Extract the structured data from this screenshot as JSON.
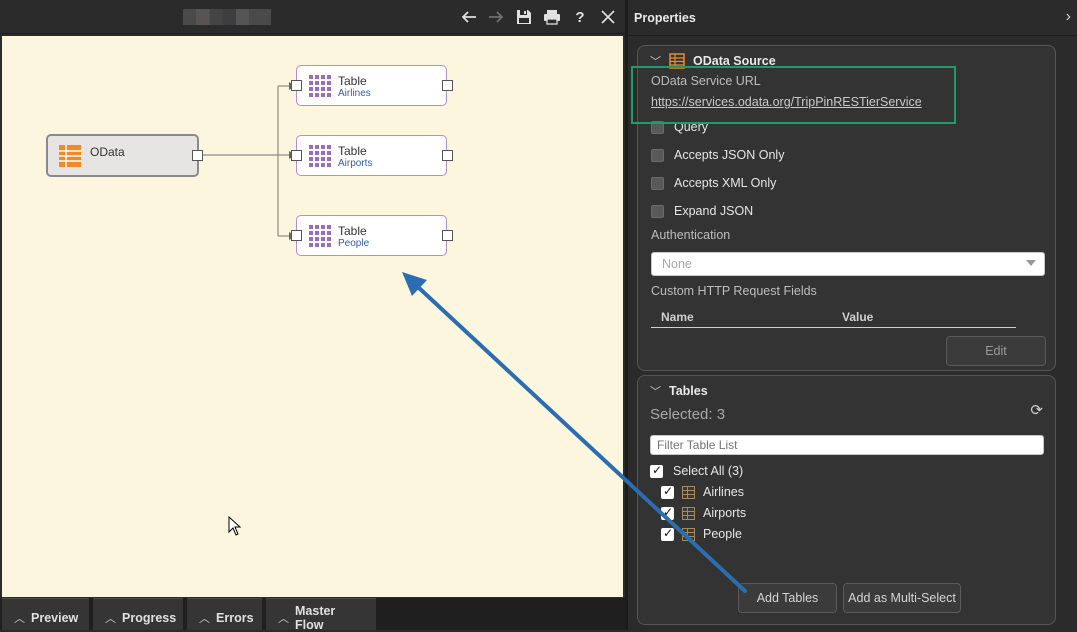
{
  "toolbar": {
    "back_icon": "arrow-left-icon",
    "forward_icon": "arrow-right-icon",
    "save_icon": "save-icon",
    "print_icon": "print-icon",
    "help_label": "?",
    "close_icon": "close-icon"
  },
  "canvas": {
    "source_node": {
      "label": "OData",
      "icon": "odata-icon"
    },
    "table_nodes": [
      {
        "title": "Table",
        "subtitle": "Airlines"
      },
      {
        "title": "Table",
        "subtitle": "Airports"
      },
      {
        "title": "Table",
        "subtitle": "People"
      }
    ]
  },
  "bottom_tabs": [
    {
      "label": "Preview"
    },
    {
      "label": "Progress"
    },
    {
      "label": "Errors"
    },
    {
      "label": "Master Flow"
    }
  ],
  "properties": {
    "title": "Properties",
    "odata_section": {
      "title": "OData Source",
      "service_url_label": "OData Service URL",
      "service_url": "https://services.odata.org/TripPinRESTierService",
      "checkboxes": [
        {
          "label": "Query",
          "checked": false
        },
        {
          "label": "Accepts JSON Only",
          "checked": false
        },
        {
          "label": "Accepts XML Only",
          "checked": false
        },
        {
          "label": "Expand JSON",
          "checked": false
        }
      ],
      "authentication_label": "Authentication",
      "authentication_value": "None",
      "http_fields_label": "Custom HTTP Request Fields",
      "columns": [
        "Name",
        "Value"
      ],
      "edit_label": "Edit"
    },
    "tables_section": {
      "title": "Tables",
      "selected_text": "Selected: 3",
      "filter_placeholder": "Filter Table List",
      "select_all_label": "Select All (3)",
      "items": [
        {
          "label": "Airlines",
          "checked": true
        },
        {
          "label": "Airports",
          "checked": true
        },
        {
          "label": "People",
          "checked": true
        }
      ],
      "add_tables_label": "Add Tables",
      "add_multi_label": "Add as Multi-Select"
    }
  },
  "colors": {
    "canvas_bg": "#fdf6df",
    "highlight": "#1f9a6b",
    "arrow": "#2a6db0",
    "table_accent": "#9a6bc3",
    "source_accent": "#f08a24"
  }
}
